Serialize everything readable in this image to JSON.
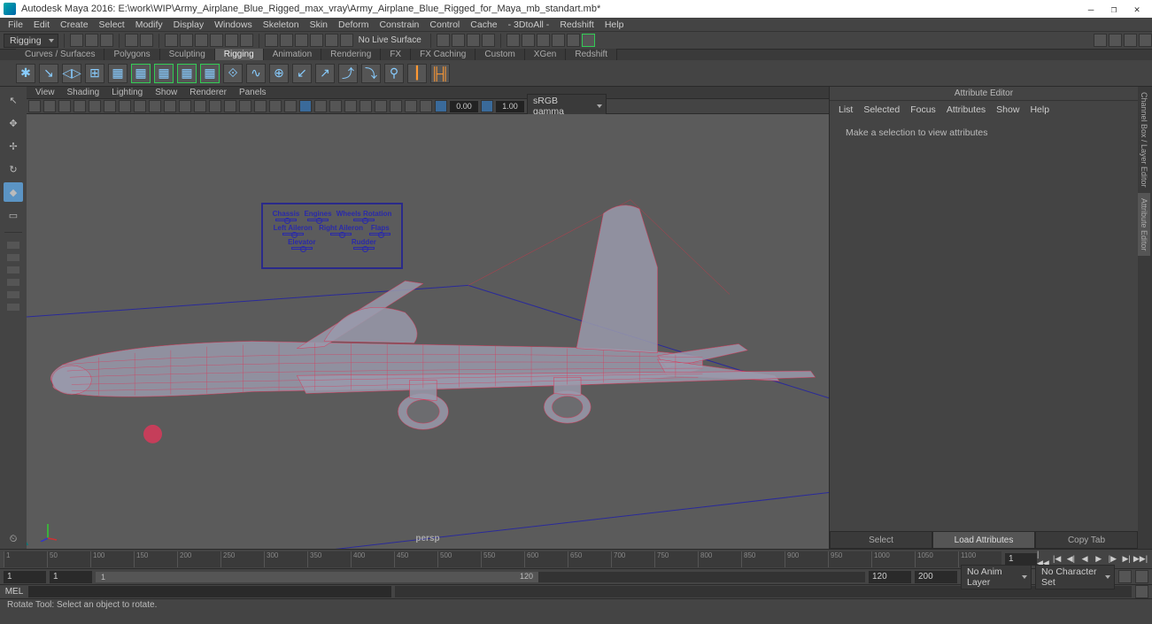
{
  "app": {
    "title": "Autodesk Maya 2016: E:\\work\\WIP\\Army_Airplane_Blue_Rigged_max_vray\\Army_Airplane_Blue_Rigged_for_Maya_mb_standart.mb*"
  },
  "menubar": [
    "File",
    "Edit",
    "Create",
    "Select",
    "Modify",
    "Display",
    "Windows",
    "Skeleton",
    "Skin",
    "Deform",
    "Constrain",
    "Control",
    "Cache",
    "- 3DtoAll -",
    "Redshift",
    "Help"
  ],
  "workspace_mode": "Rigging",
  "live_surface": "No Live Surface",
  "shelf_tabs": [
    "Curves / Surfaces",
    "Polygons",
    "Sculpting",
    "Rigging",
    "Animation",
    "Rendering",
    "FX",
    "FX Caching",
    "Custom",
    "XGen",
    "Redshift"
  ],
  "shelf_active": "Rigging",
  "panel_menu": [
    "View",
    "Shading",
    "Lighting",
    "Show",
    "Renderer",
    "Panels"
  ],
  "panel_num1": "0.00",
  "panel_num2": "1.00",
  "panel_colorspace": "sRGB gamma",
  "viewport": {
    "camera": "persp"
  },
  "control_panel": {
    "row1": [
      "Chassis",
      "Engines",
      "Wheels Rotation"
    ],
    "row2": [
      "Left Aileron",
      "Right Aileron",
      "Flaps"
    ],
    "row3": [
      "Elevator",
      "Rudder"
    ]
  },
  "attribute_editor": {
    "title": "Attribute Editor",
    "menu": [
      "List",
      "Selected",
      "Focus",
      "Attributes",
      "Show",
      "Help"
    ],
    "message": "Make a selection to view attributes",
    "buttons": [
      "Select",
      "Load Attributes",
      "Copy Tab"
    ],
    "active_button": 1,
    "side_tabs": [
      "Channel Box / Layer Editor",
      "Attribute Editor"
    ]
  },
  "timeline": {
    "ticks": [
      "1",
      "50",
      "100",
      "150",
      "200",
      "250",
      "300",
      "350",
      "400",
      "450",
      "500",
      "550",
      "600",
      "650",
      "700",
      "750",
      "800",
      "850",
      "900",
      "950",
      "1000",
      "1050",
      "1100"
    ],
    "cur_input": "1"
  },
  "range": {
    "start_outer": "1",
    "start_inner": "1",
    "drag_start": "1",
    "drag_end": "120",
    "end_inner": "120",
    "end_outer": "200",
    "anim_layer": "No Anim Layer",
    "char_set": "No Character Set"
  },
  "cmd": {
    "lang": "MEL"
  },
  "helpline": "Rotate Tool: Select an object to rotate."
}
